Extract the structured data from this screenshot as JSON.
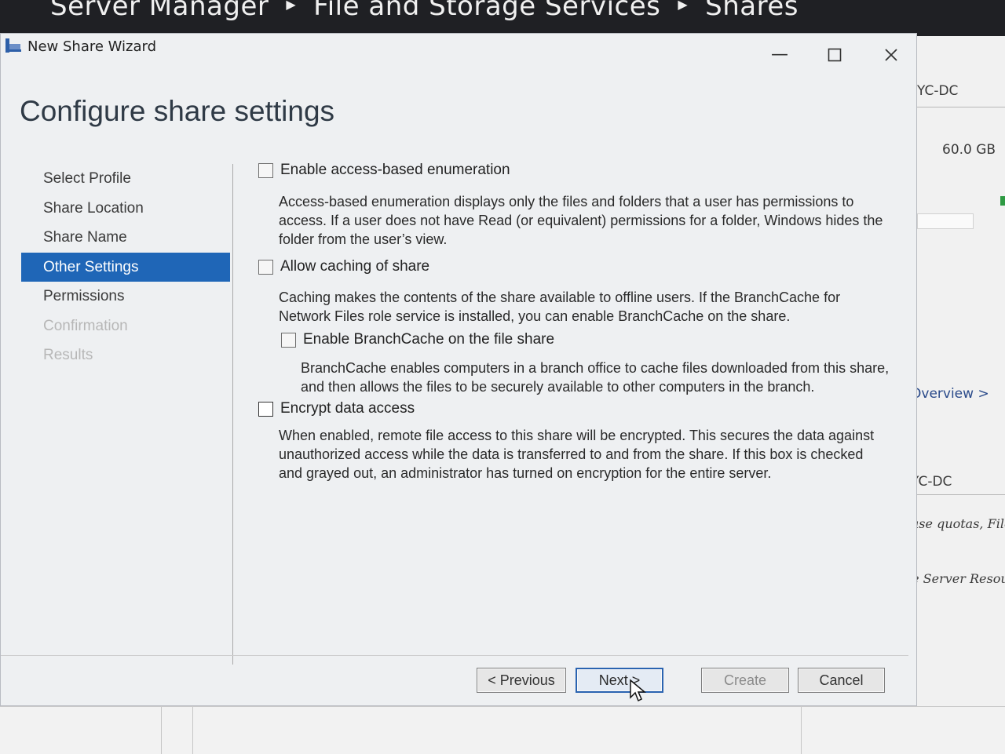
{
  "server_manager": {
    "breadcrumb": [
      "Server Manager",
      "File and Storage Services",
      "Shares"
    ],
    "background_panel": {
      "server_name_1": "YC-DC",
      "capacity": "60.0 GB",
      "overview_link": "Overview >",
      "server_name_2": "YC-DC",
      "quota_text": "use quotas, File",
      "fsrm_text": "le Server Resourc"
    }
  },
  "dialog": {
    "title": "New Share Wizard",
    "heading": "Configure share settings",
    "nav": [
      {
        "label": "Select Profile",
        "state": "normal"
      },
      {
        "label": "Share Location",
        "state": "normal"
      },
      {
        "label": "Share Name",
        "state": "normal"
      },
      {
        "label": "Other Settings",
        "state": "selected"
      },
      {
        "label": "Permissions",
        "state": "normal"
      },
      {
        "label": "Confirmation",
        "state": "disabled"
      },
      {
        "label": "Results",
        "state": "disabled"
      }
    ],
    "options": {
      "abe": {
        "label": "Enable access-based enumeration",
        "checked": false,
        "desc": [
          "Access-based enumeration displays only the files and folders that a user has permissions to",
          "access. If a user does not have Read (or equivalent) permissions for a folder, Windows hides the",
          "folder from the user’s view."
        ]
      },
      "caching": {
        "label": "Allow caching of share",
        "checked": false,
        "desc": [
          "Caching makes the contents of the share available to offline users. If the BranchCache for",
          "Network Files role service is installed, you can enable BranchCache on the share."
        ]
      },
      "branchcache": {
        "label": "Enable BranchCache on the file share",
        "checked": false,
        "desc": [
          "BranchCache enables computers in a branch office to cache files downloaded from this share,",
          "and then allows the files to be securely available to other computers in the branch."
        ]
      },
      "encrypt": {
        "label": "Encrypt data access",
        "checked": false,
        "desc": [
          "When enabled, remote file access to this share will be encrypted. This secures the data against",
          "unauthorized access while the data is transferred to and from the share. If this box is checked",
          "and grayed out, an administrator has turned on encryption for the entire server."
        ]
      }
    },
    "buttons": {
      "previous": "< Previous",
      "next": "Next >",
      "create": "Create",
      "cancel": "Cancel"
    }
  },
  "colors": {
    "selected_nav_bg": "#1f66b7",
    "header_bg": "#1f2024",
    "primary_button_border": "#2a63b0"
  }
}
